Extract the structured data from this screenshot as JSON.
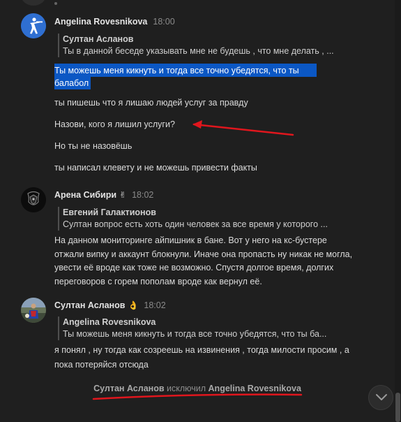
{
  "messages": [
    {
      "author": "Angelina Rovesnikova",
      "time": "18:00",
      "quote": {
        "author": "Султан Асланов",
        "text": "Ты в данной беседе указывать мне не будешь , что мне делать , ..."
      },
      "highlighted_text": "Ты можешь меня кикнуть и тогда все точно убедятся, что ты балабол",
      "lines": [
        "ты пишешь что я лишаю людей услуг за правду",
        "Назови, кого я лишил услуги?",
        "Но ты не назовёшь",
        "ты написал клевету и не можешь привести факты"
      ]
    },
    {
      "author": "Арена Сибири",
      "emoji": "✌",
      "time": "18:02",
      "quote": {
        "author": "Евгений Галактионов",
        "text": "Султан вопрос есть хоть один человек за все время у которого ..."
      },
      "text": "На данном мониторинге айпишник в бане. Вот у него на кс-бустере отжали випку и аккаунт блокнули. Иначе она пропасть ну никак не могла, увести её вроде как тоже не возможно. Спустя долгое время, долгих переговоров с горем пополам вроде как вернул её."
    },
    {
      "author": "Султан Асланов",
      "emoji": "👌",
      "time": "18:02",
      "quote": {
        "author": "Angelina Rovesnikova",
        "text": "Ты можешь меня кикнуть и тогда все точно убедятся, что ты ба..."
      },
      "text": "я понял , ну тогда как созреешь на извинения , тогда милости просим , а пока потеряйся отсюда"
    }
  ],
  "service_message": {
    "actor": "Султан Асланов",
    "action": "исключил",
    "target": "Angelina Rovesnikova"
  },
  "icons": {
    "avatar1": "counter-strike-silhouette-avatar",
    "avatar2": "dark-logo-avatar",
    "avatar3": "photo-avatar",
    "scroll_down": "chevron-down-icon"
  },
  "colors": {
    "background": "#1f1f1f",
    "selection": "#0b57c4",
    "annotation": "#e0161d",
    "avatar_blue": "#2f6fd1"
  }
}
